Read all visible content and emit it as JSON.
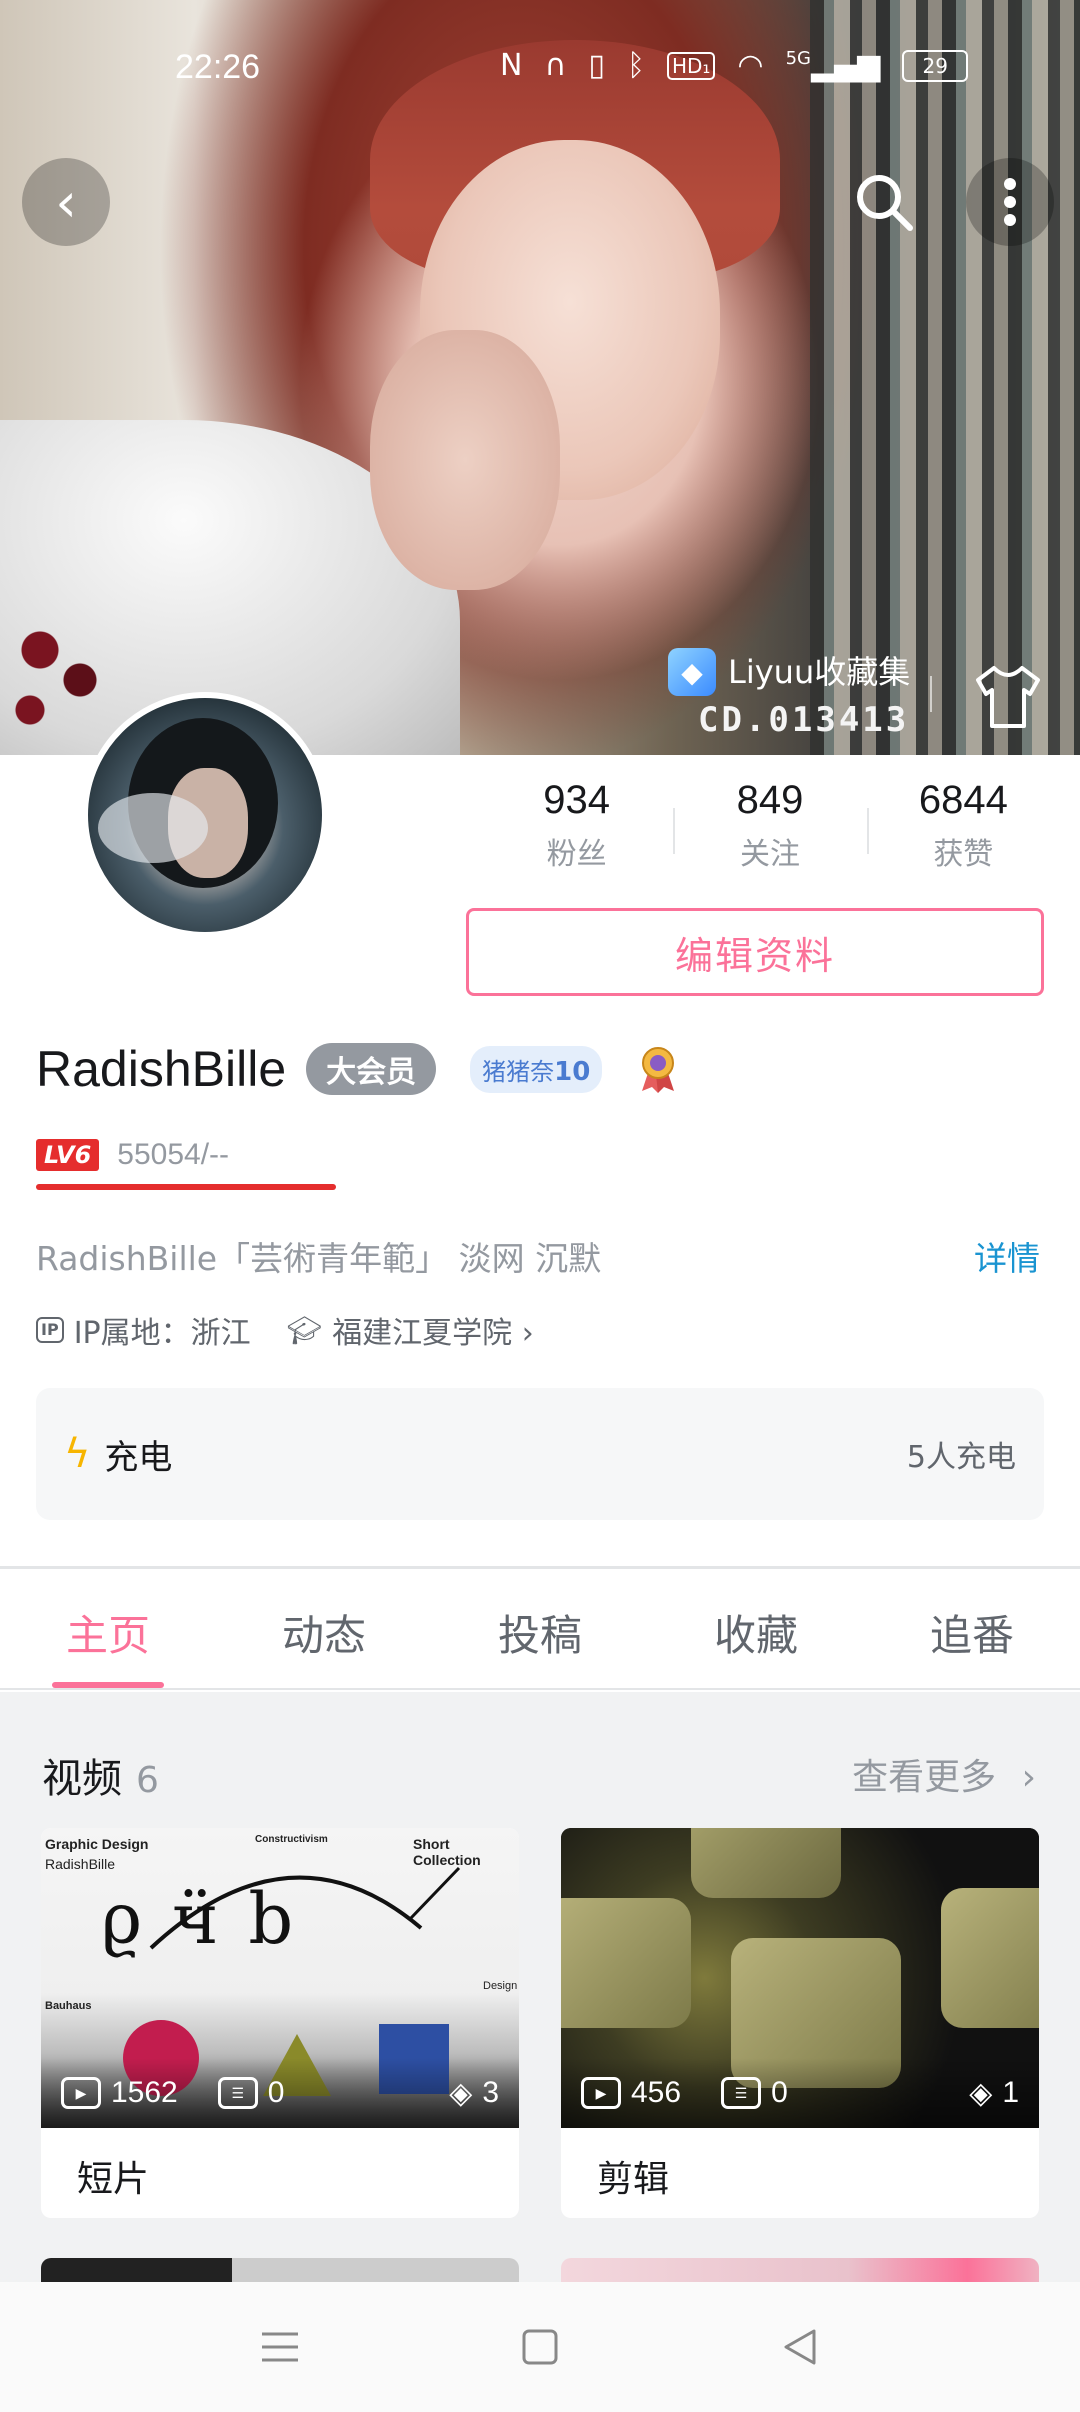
{
  "status_bar": {
    "time": "22:26",
    "icons": [
      "nfc-icon",
      "headphones-icon",
      "vibrate-icon",
      "bluetooth-icon",
      "hd-icon",
      "wifi-icon",
      "signal-5g-icon"
    ],
    "hd_label": "HD₁",
    "network_label": "5G",
    "battery": "29"
  },
  "banner": {
    "collection_name": "Liyuu收藏集",
    "collection_code": "CD.013413"
  },
  "profile": {
    "stats": [
      {
        "value": "934",
        "label": "粉丝"
      },
      {
        "value": "849",
        "label": "关注"
      },
      {
        "value": "6844",
        "label": "获赞"
      }
    ],
    "edit_button": "编辑资料",
    "username": "RadishBille",
    "vip_badge": "大会员",
    "medal_name": "猪猪奈",
    "medal_level": "10",
    "level_badge": "LV6",
    "exp": "55054/--",
    "exp_progress": 1.0,
    "signature": "RadishBille「芸術青年範」 淡网 沉默",
    "detail_link": "详情",
    "ip_tag": "IP",
    "ip_location": "IP属地：浙江",
    "school": "福建江夏学院",
    "school_chevron": "›"
  },
  "charge": {
    "title": "充电",
    "count": "5人充电"
  },
  "tabs": [
    {
      "label": "主页",
      "active": true
    },
    {
      "label": "动态",
      "active": false
    },
    {
      "label": "投稿",
      "active": false
    },
    {
      "label": "收藏",
      "active": false
    },
    {
      "label": "追番",
      "active": false
    }
  ],
  "videos": {
    "title": "视频",
    "count": "6",
    "see_more": "查看更多",
    "items": [
      {
        "title": "短片",
        "plays": "1562",
        "comments": "0",
        "layers": "3",
        "thumb_texts": {
          "a": "Graphic Design",
          "b": "RadishBille",
          "c": "Constructivism",
          "d": "Short Collection",
          "e": "Bauhaus",
          "f": "Design"
        }
      },
      {
        "title": "剪辑",
        "plays": "456",
        "comments": "0",
        "layers": "1"
      }
    ]
  },
  "colors": {
    "accent_pink": "#fb7299",
    "link_blue": "#1a94d1",
    "level_red": "#e52d2d",
    "charge_yellow": "#f7b500"
  }
}
